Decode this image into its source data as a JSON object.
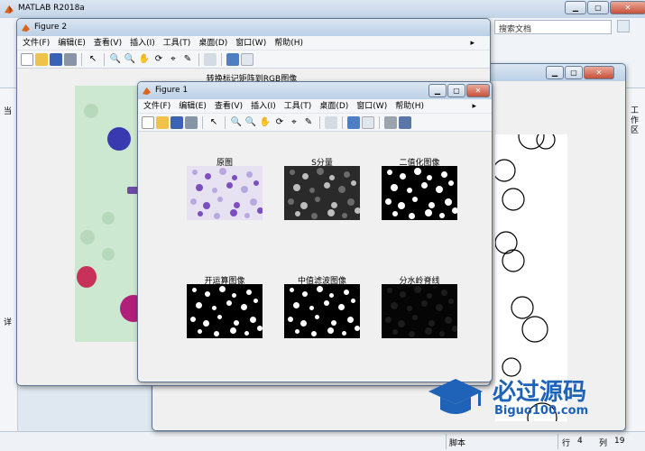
{
  "main": {
    "title": "MATLAB R2018a",
    "search_placeholder": "搜索文档",
    "status_script": "脚本",
    "status_row_label": "行",
    "status_row": "4",
    "status_col_label": "列",
    "status_col": "19",
    "right_panel_label": "工作区",
    "left_panel_glyph": "当",
    "left_panel_glyph2": "详"
  },
  "figure2": {
    "title": "Figure 2",
    "menu": [
      "文件(F)",
      "编辑(E)",
      "查看(V)",
      "插入(I)",
      "工具(T)",
      "桌面(D)",
      "窗口(W)",
      "帮助(H)"
    ],
    "axes_title": "转换标记矩阵到RGB图像"
  },
  "figure1": {
    "title": "Figure 1",
    "menu": [
      "文件(F)",
      "编辑(E)",
      "查看(V)",
      "插入(I)",
      "工具(T)",
      "桌面(D)",
      "窗口(W)",
      "帮助(H)"
    ],
    "subplots": [
      {
        "title": "原图"
      },
      {
        "title": "S分量"
      },
      {
        "title": "二值化图像"
      },
      {
        "title": "开运算图像"
      },
      {
        "title": "中值滤波图像"
      },
      {
        "title": "分水岭脊线"
      }
    ]
  },
  "watermark": {
    "text_cn": "必过源码",
    "text_en": "Biguo100.com"
  },
  "colors": {
    "accent": "#1f63b8",
    "titlebar": "#c4d4e6",
    "close": "#c8503a"
  }
}
